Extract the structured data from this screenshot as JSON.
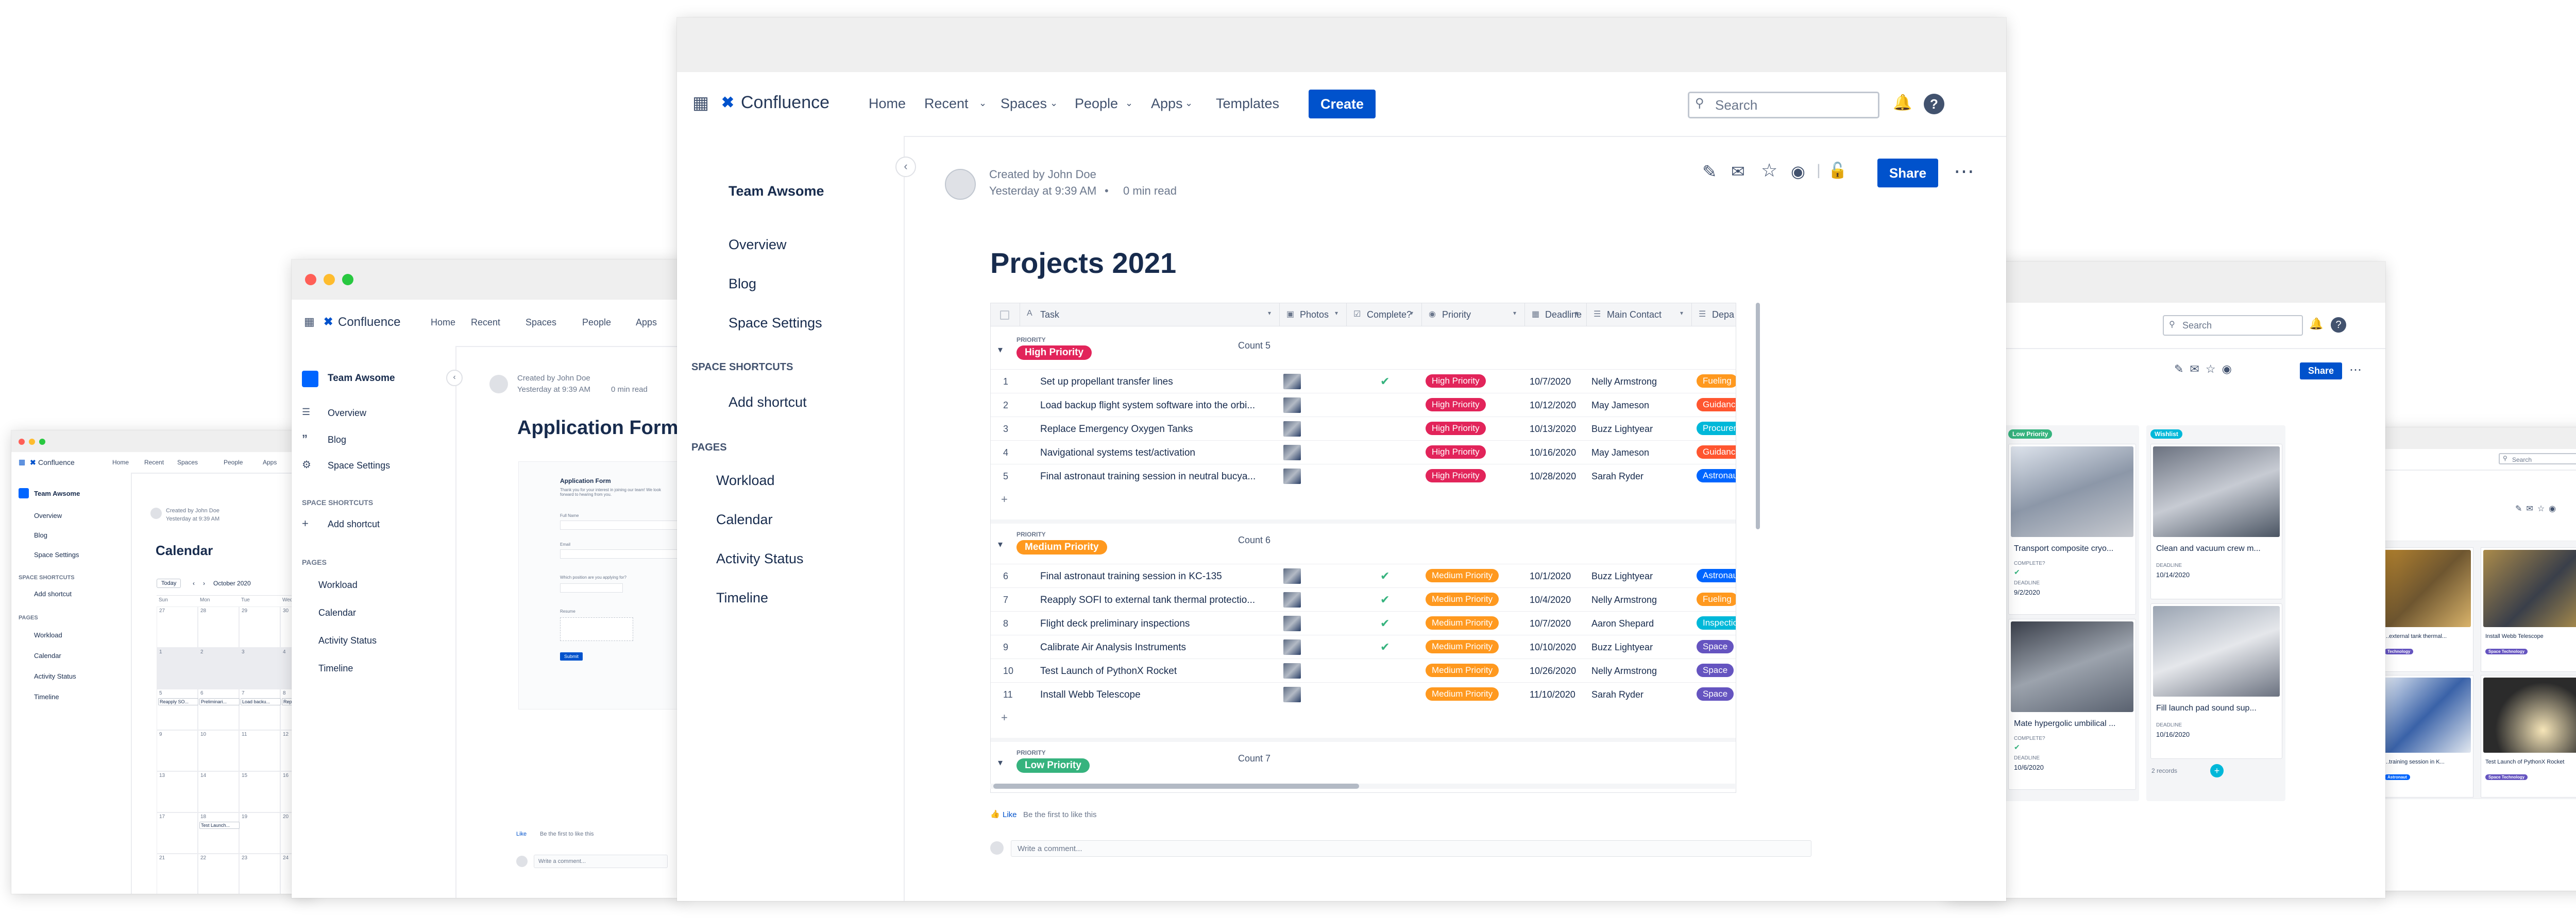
{
  "brand": "Confluence",
  "nav": {
    "home": "Home",
    "recent": "Recent",
    "spaces": "Spaces",
    "people": "People",
    "apps": "Apps",
    "templates": "Templates",
    "create": "Create",
    "search_placeholder": "Search"
  },
  "space": {
    "name": "Team Awsome",
    "overview": "Overview",
    "blog": "Blog",
    "settings": "Space Settings",
    "shortcuts_heading": "SPACE SHORTCUTS",
    "add_shortcut": "Add shortcut",
    "pages_heading": "PAGES",
    "pages": [
      "Workload",
      "Calendar",
      "Activity Status",
      "Timeline"
    ]
  },
  "byline": {
    "created": "Created by John Doe",
    "time": "Yesterday at 9:39 AM",
    "read": "0 min read"
  },
  "share": "Share",
  "main_page": {
    "title": "Projects 2021",
    "columns": [
      "Task",
      "Photos",
      "Complete?",
      "Priority",
      "Deadline",
      "Main Contact",
      "Depa"
    ],
    "group_label": "PRIORITY",
    "groups": [
      {
        "name": "High Priority",
        "color": "#e2245a",
        "count": "Count 5",
        "rows": [
          {
            "n": "1",
            "task": "Set up propellant transfer lines",
            "done": true,
            "deadline": "10/7/2020",
            "contact": "Nelly Armstrong",
            "dept": "Fueling",
            "dept_color": "#ff991f"
          },
          {
            "n": "2",
            "task": "Load backup flight system software into the orbi...",
            "done": false,
            "deadline": "10/12/2020",
            "contact": "May Jameson",
            "dept": "Guidance",
            "dept_color": "#ff5630"
          },
          {
            "n": "3",
            "task": "Replace Emergency Oxygen Tanks",
            "done": false,
            "deadline": "10/13/2020",
            "contact": "Buzz Lightyear",
            "dept": "Procurement",
            "dept_color": "#00b8d9"
          },
          {
            "n": "4",
            "task": "Navigational systems test/activation",
            "done": false,
            "deadline": "10/16/2020",
            "contact": "May Jameson",
            "dept": "Guidance",
            "dept_color": "#ff5630"
          },
          {
            "n": "5",
            "task": "Final astronaut training session in neutral bucya...",
            "done": false,
            "deadline": "10/28/2020",
            "contact": "Sarah Ryder",
            "dept": "Astronaut",
            "dept_color": "#0065ff"
          }
        ]
      },
      {
        "name": "Medium Priority",
        "color": "#ff991f",
        "count": "Count 6",
        "rows": [
          {
            "n": "6",
            "task": "Final astronaut training session in KC-135",
            "done": true,
            "deadline": "10/1/2020",
            "contact": "Buzz Lightyear",
            "dept": "Astronaut",
            "dept_color": "#0065ff"
          },
          {
            "n": "7",
            "task": "Reapply SOFI to external tank thermal protectio...",
            "done": true,
            "deadline": "10/4/2020",
            "contact": "Nelly Armstrong",
            "dept": "Fueling",
            "dept_color": "#ff991f"
          },
          {
            "n": "8",
            "task": "Flight deck preliminary inspections",
            "done": true,
            "deadline": "10/7/2020",
            "contact": "Aaron Shepard",
            "dept": "Inspection",
            "dept_color": "#00b8d9"
          },
          {
            "n": "9",
            "task": "Calibrate Air Analysis Instruments",
            "done": true,
            "deadline": "10/10/2020",
            "contact": "Buzz Lightyear",
            "dept": "Space",
            "dept_color": "#6554c0"
          },
          {
            "n": "10",
            "task": "Test Launch of PythonX Rocket",
            "done": false,
            "deadline": "10/26/2020",
            "contact": "Nelly Armstrong",
            "dept": "Space",
            "dept_color": "#6554c0"
          },
          {
            "n": "11",
            "task": "Install Webb Telescope",
            "done": false,
            "deadline": "11/10/2020",
            "contact": "Sarah Ryder",
            "dept": "Space",
            "dept_color": "#6554c0"
          }
        ]
      },
      {
        "name": "Low Priority",
        "color": "#36b37e",
        "count": "Count 7",
        "rows": []
      }
    ],
    "add_row": "+",
    "like": "Like",
    "like_note": "Be the first to like this",
    "comment_placeholder": "Write a comment..."
  },
  "form_page": {
    "title": "Application Form",
    "inner_title": "Application Form",
    "inner_intro": "Thank you for your interest in joining our team! We look forward to hearing from you.",
    "field1": "Full Name",
    "field2": "Email",
    "field3": "Which position are you applying for?",
    "field4": "Resume",
    "submit": "Submit",
    "like": "Like",
    "like_note": "Be the first to like this",
    "comment": "Write a comment..."
  },
  "calendar_page": {
    "title": "Calendar",
    "today": "Today",
    "month": "October 2020",
    "weekdays": [
      "Sun",
      "Mon",
      "Tue",
      "Wed"
    ],
    "days": [
      "27",
      "28",
      "29",
      "30",
      "1",
      "2",
      "3",
      "4",
      "5",
      "6",
      "7",
      "8",
      "9",
      "10",
      "11",
      "12",
      "13",
      "14",
      "15",
      "16",
      "17",
      "18",
      "19",
      "20",
      "21",
      "22",
      "23",
      "24",
      "25",
      "26",
      "27",
      "28"
    ],
    "events": [
      "Reapply SO...",
      "Preliminari...",
      "Load backu...",
      "Replace Em...",
      "Test Launch..."
    ]
  },
  "board_page": {
    "col1": "Low Priority",
    "col2": "Wishlist",
    "cards": [
      {
        "title": "Transport composite cryo...",
        "label": "COMPLETE?",
        "label2": "DEADLINE",
        "date": "9/2/2020"
      },
      {
        "title": "Clean and vacuum crew m...",
        "label": "DEADLINE",
        "date": "10/14/2020"
      },
      {
        "title": "Mate hypergolic umbilical ...",
        "label": "COMPLETE?",
        "label2": "DEADLINE",
        "date": "10/6/2020"
      },
      {
        "title": "Fill launch pad sound sup...",
        "label": "DEADLINE",
        "date": "10/16/2020"
      }
    ],
    "count": "2 records"
  },
  "gallery_page": {
    "cards": [
      {
        "title": "...external tank thermal...",
        "tag": "Technology",
        "tag_color": "#6554c0"
      },
      {
        "title": "Install Webb Telescope",
        "tag": "Space Technology",
        "tag_color": "#6554c0"
      },
      {
        "title": "...training session in K...",
        "tag": "Astronaut",
        "tag_color": "#0065ff"
      },
      {
        "title": "Test Launch of PythonX Rocket",
        "tag": "Space Technology",
        "tag_color": "#6554c0"
      }
    ]
  },
  "colors": {
    "accent": "#0052cc",
    "brand": "#0052cc",
    "text": "#172b4d",
    "muted": "#6b778c"
  }
}
